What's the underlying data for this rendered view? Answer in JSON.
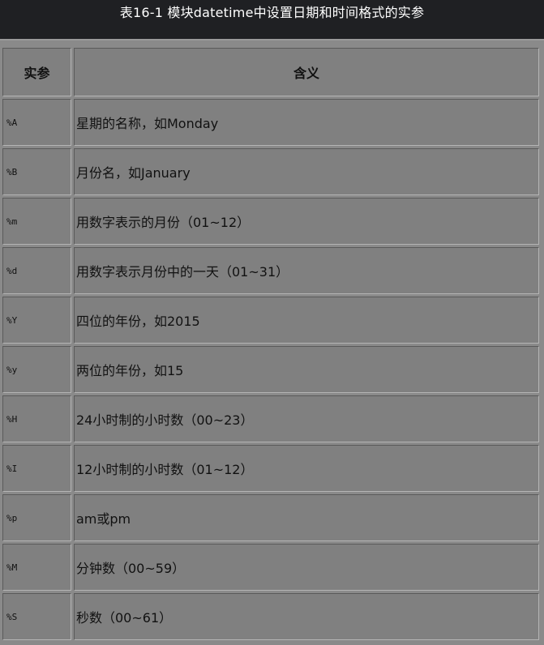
{
  "title": "表16-1 模块datetime中设置日期和时间格式的实参",
  "table": {
    "headers": [
      "实参",
      "含义"
    ],
    "rows": [
      {
        "code": "%A",
        "meaning": "星期的名称，如Monday"
      },
      {
        "code": "%B",
        "meaning": "月份名，如January"
      },
      {
        "code": "%m",
        "meaning": "用数字表示的月份（01~12）"
      },
      {
        "code": "%d",
        "meaning": "用数字表示月份中的一天（01~31）"
      },
      {
        "code": "%Y",
        "meaning": "四位的年份，如2015"
      },
      {
        "code": "%y",
        "meaning": "两位的年份，如15"
      },
      {
        "code": "%H",
        "meaning": "24小时制的小时数（00~23）"
      },
      {
        "code": "%I",
        "meaning": "12小时制的小时数（01~12）"
      },
      {
        "code": "%p",
        "meaning": "am或pm"
      },
      {
        "code": "%M",
        "meaning": "分钟数（00~59）"
      },
      {
        "code": "%S",
        "meaning": "秒数（00~61）"
      }
    ]
  }
}
